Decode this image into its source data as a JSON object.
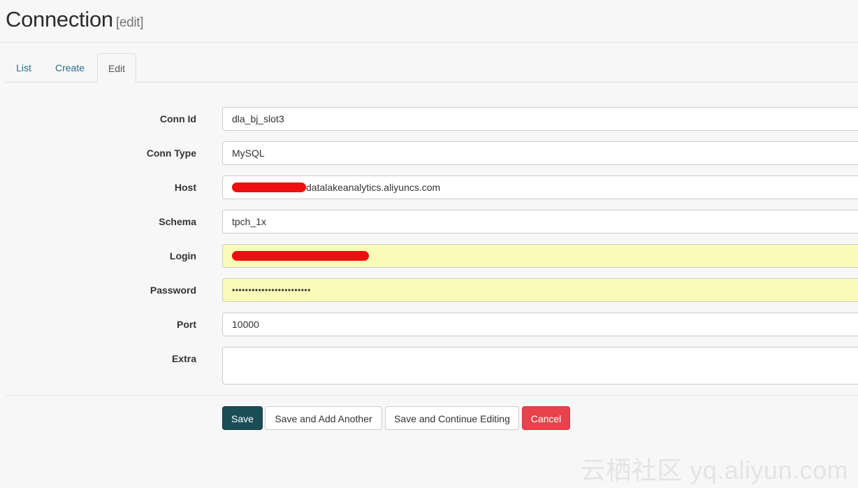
{
  "header": {
    "title": "Connection",
    "subtitle": "[edit]"
  },
  "tabs": [
    {
      "label": "List",
      "active": false
    },
    {
      "label": "Create",
      "active": false
    },
    {
      "label": "Edit",
      "active": true
    }
  ],
  "form": {
    "conn_id": {
      "label": "Conn Id",
      "value": "dla_bj_slot3"
    },
    "conn_type": {
      "label": "Conn Type",
      "value": "MySQL"
    },
    "host": {
      "label": "Host",
      "value_suffix": "datalakeanalytics.aliyuncs.com",
      "redacted_prefix": true
    },
    "schema": {
      "label": "Schema",
      "value": "tpch_1x"
    },
    "login": {
      "label": "Login",
      "redacted": true,
      "autofill": true
    },
    "password": {
      "label": "Password",
      "value": "••••••••••••••••••••••••",
      "autofill": true
    },
    "port": {
      "label": "Port",
      "value": "10000"
    },
    "extra": {
      "label": "Extra",
      "value": ""
    }
  },
  "buttons": {
    "save": "Save",
    "save_add_another": "Save and Add Another",
    "save_continue": "Save and Continue Editing",
    "cancel": "Cancel"
  },
  "colors": {
    "primary_button": "#1b4d57",
    "cancel_button": "#e8424d",
    "tab_link": "#2a6f86",
    "autofill_background": "#fafbb8",
    "redaction": "#ee1010"
  },
  "watermark": "云栖社区 yq.aliyun.com"
}
